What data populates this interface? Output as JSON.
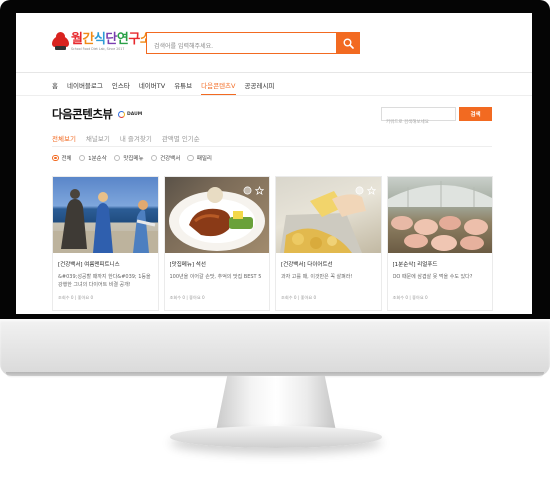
{
  "header": {
    "logo_title_parts": [
      "월",
      "간",
      "식",
      "단",
      "연",
      "구",
      "소"
    ],
    "logo_subtitle": "School Food Diet Lab, Since 2017",
    "search_placeholder": "검색어를 입력해주세요."
  },
  "nav": {
    "items": [
      "홈",
      "네이버블로그",
      "인스타",
      "네이버TV",
      "유튜브",
      "다음콘텐츠V",
      "공공레시피"
    ],
    "active_index": 5
  },
  "page": {
    "title": "다음콘텐츠뷰",
    "badge_label": "DAUM",
    "sub_search_placeholder": "키워드로 검색해보세요",
    "sub_search_button": "검색"
  },
  "tabs": {
    "items": [
      "전체보기",
      "채널보기",
      "내 즐겨찾기",
      "관액별 인기순"
    ],
    "active_index": 0
  },
  "filters": {
    "items": [
      "전체",
      "1분순삭",
      "맛집메뉴",
      "건강백서",
      "패밀리"
    ],
    "selected_index": 0
  },
  "cards": [
    {
      "title": "[건강백서] 여름맨피트니스",
      "desc": "&#039;성공할 때까지 한다&#039; 1등을 강행한 그녀의 다이어트 비결 공개!",
      "meta": "조회수 0 | 좋아요 0",
      "image": "woman-by-lake-photo"
    },
    {
      "title": "[맛집메뉴] 석선",
      "desc": "100년을 이어갈 손맛, 추억의 맛집 BEST 5",
      "meta": "조회수 0 | 좋아요 0",
      "image": "steak-plate-photo"
    },
    {
      "title": "[건강백서] 다이어트선",
      "desc": "과자 고를 때, 이것만은 꼭 살펴라!",
      "meta": "조회수 0 | 좋아요 0",
      "image": "snack-bag-photo"
    },
    {
      "title": "[1분순삭] 리얼푸드",
      "desc": "OO 때문에 삼겹살 못 먹을 수도 있다?",
      "meta": "조회수 0 | 좋아요 0",
      "image": "pig-farm-photo"
    }
  ],
  "colors": {
    "accent": "#f26a21",
    "bezel": "#050505"
  }
}
